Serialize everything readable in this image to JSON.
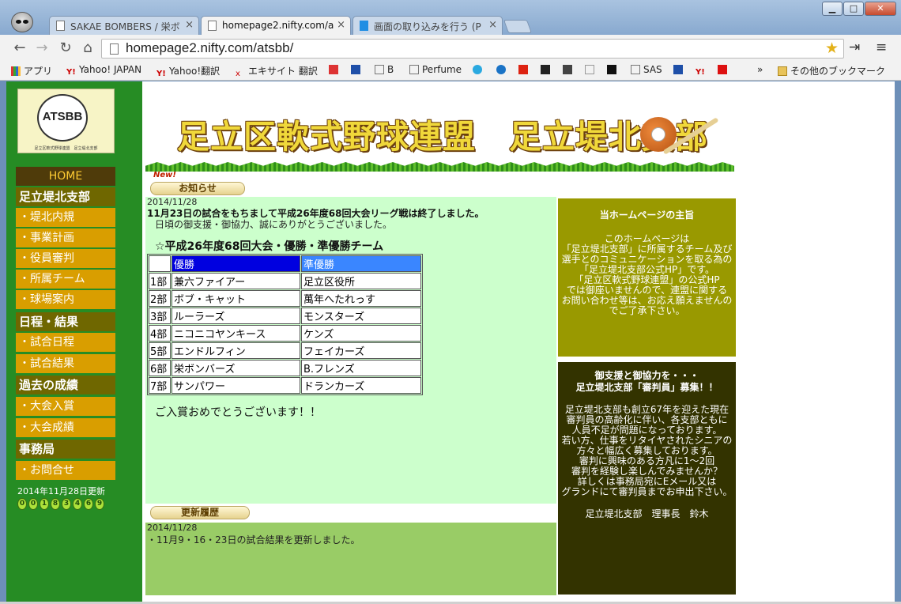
{
  "browser": {
    "tabs": [
      {
        "title": "SAKAE BOMBERS / 栄ボ"
      },
      {
        "title": "homepage2.nifty.com/a"
      },
      {
        "title": "画面の取り込みを行う (P"
      }
    ],
    "close_glyph": "×",
    "url": "homepage2.nifty.com/atsbb/",
    "bookmarks": [
      "アプリ",
      "Yahoo! JAPAN",
      "Yahoo!翻訳",
      "エキサイト 翻訳",
      "B",
      "Perfume",
      "SAS",
      "»",
      "その他のブックマーク"
    ]
  },
  "sidebar": {
    "logo_text": "ATSBB",
    "logo_caption": "足立区軟式野球連盟　足立堤北支部",
    "home": "HOME",
    "sections": [
      {
        "head": "足立堤北支部",
        "items": [
          "・堤北内規",
          "・事業計画",
          "・役員審判",
          "・所属チーム",
          "・球場案内"
        ]
      },
      {
        "head": "日程・結果",
        "items": [
          "・試合日程",
          "・試合結果"
        ]
      },
      {
        "head": "過去の成績",
        "items": [
          "・大会入賞",
          "・大会成績"
        ]
      },
      {
        "head": "事務局",
        "items": [
          "・お問合せ"
        ]
      }
    ],
    "updated": "2014年11月28日更新",
    "counter": [
      "0",
      "0",
      "1",
      "8",
      "3",
      "4",
      "6",
      "9"
    ]
  },
  "banner": {
    "title": "足立区軟式野球連盟　足立堤北支部",
    "new_mark": "New!"
  },
  "news": {
    "label": "お知らせ",
    "date": "2014/11/28",
    "headline": "11月23日の試合をもちまして平成26年度68回大会リーグ戦は終了しました。",
    "thanks": "日頃の御支援・御協力、誠にありがとうございました。",
    "table_title": "☆平成26年度68回大会・優勝・準優勝チーム",
    "table_header": [
      "",
      "優勝",
      "準優勝"
    ],
    "rows": [
      [
        "1部",
        "兼六ファイアー",
        "足立区役所"
      ],
      [
        "2部",
        "ボブ・キャット",
        "萬年へたれっす"
      ],
      [
        "3部",
        "ルーラーズ",
        "モンスターズ"
      ],
      [
        "4部",
        "ニコニコヤンキース",
        "ケンズ"
      ],
      [
        "5部",
        "エンドルフィン",
        "フェイカーズ"
      ],
      [
        "6部",
        "栄ボンバーズ",
        "B.フレンズ"
      ],
      [
        "7部",
        "サンパワー",
        "ドランカーズ"
      ]
    ],
    "congrats": "ご入賞おめでとうございます！！"
  },
  "updates": {
    "label": "更新履歴",
    "date": "2014/11/28",
    "text": "・11月9・16・23日の試合結果を更新しました。"
  },
  "purpose": {
    "heading": "当ホームページの主旨",
    "body": "このホームページは\n「足立堤北支部」に所属するチーム及び\n選手とのコミュニケーションを取る為の\n「足立堤北支部公式HP」です。\n「足立区軟式野球連盟」の公式HP\nでは御座いませんので、連盟に関する\nお問い合わせ等は、お応え願えませんの\nでご了承下さい。"
  },
  "recruit": {
    "heading": "御支援と御協力を・・・\n足立堤北支部「審判員」募集！！",
    "body": "足立堤北支部も創立67年を迎えた現在\n審判員の高齢化に伴い、各支部ともに\n人員不足が問題になっております。\n若い方、仕事をリタイヤされたシニアの\n方々と幅広く募集しております。\n審判に興味のある方凡に1～2回\n審判を経験し楽しんでみませんか？\n詳しくは事務局宛にEメール又は\nグランドにて審判員までお申出下さい。",
    "signature": "足立堤北支部　理事長　鈴木"
  }
}
